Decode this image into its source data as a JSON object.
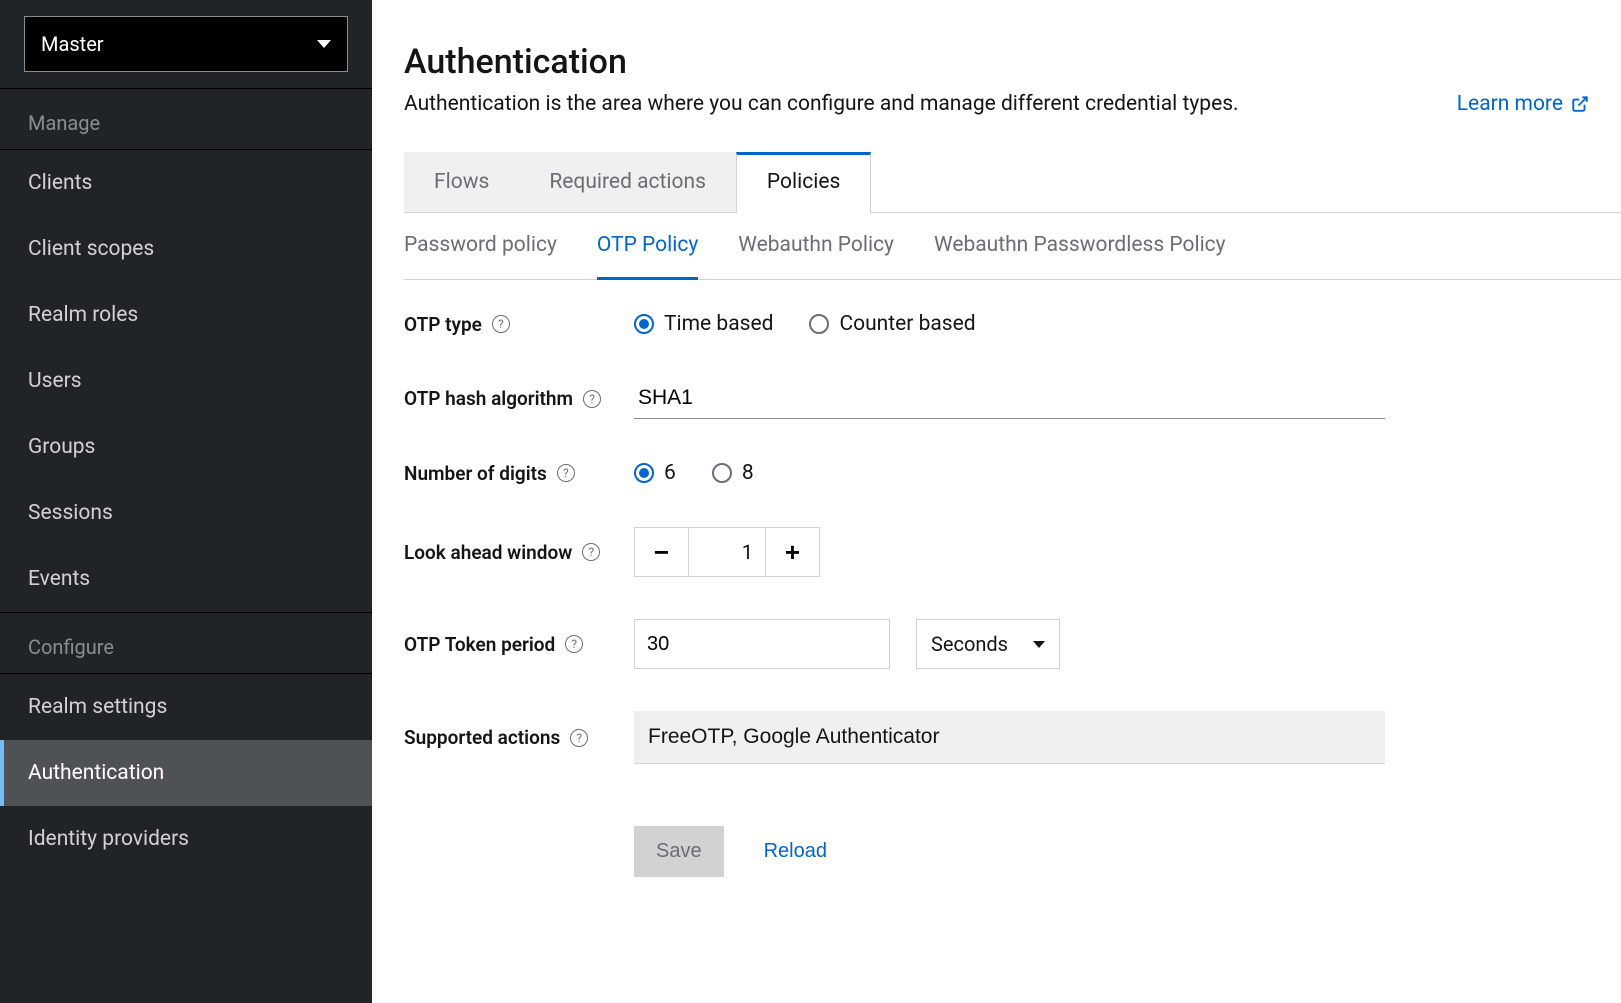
{
  "realm": {
    "selected": "Master"
  },
  "sidebar": {
    "sections": [
      {
        "title": "Manage",
        "items": [
          {
            "label": "Clients"
          },
          {
            "label": "Client scopes"
          },
          {
            "label": "Realm roles"
          },
          {
            "label": "Users"
          },
          {
            "label": "Groups"
          },
          {
            "label": "Sessions"
          },
          {
            "label": "Events"
          }
        ]
      },
      {
        "title": "Configure",
        "items": [
          {
            "label": "Realm settings"
          },
          {
            "label": "Authentication"
          },
          {
            "label": "Identity providers"
          }
        ]
      }
    ]
  },
  "page": {
    "title": "Authentication",
    "description": "Authentication is the area where you can configure and manage different credential types.",
    "learn_more": "Learn more"
  },
  "tabs_primary": [
    {
      "label": "Flows"
    },
    {
      "label": "Required actions"
    },
    {
      "label": "Policies"
    }
  ],
  "tabs_secondary": [
    {
      "label": "Password policy"
    },
    {
      "label": "OTP Policy"
    },
    {
      "label": "Webauthn Policy"
    },
    {
      "label": "Webauthn Passwordless Policy"
    }
  ],
  "form": {
    "otp_type": {
      "label": "OTP type",
      "options": {
        "time": "Time based",
        "counter": "Counter based"
      }
    },
    "hash_algo": {
      "label": "OTP hash algorithm",
      "value": "SHA1"
    },
    "digits": {
      "label": "Number of digits",
      "options": {
        "six": "6",
        "eight": "8"
      }
    },
    "look_ahead": {
      "label": "Look ahead window",
      "value": "1"
    },
    "token_period": {
      "label": "OTP Token period",
      "value": "30",
      "unit": "Seconds"
    },
    "supported": {
      "label": "Supported actions",
      "value": "FreeOTP, Google Authenticator"
    },
    "buttons": {
      "save": "Save",
      "reload": "Reload"
    }
  }
}
